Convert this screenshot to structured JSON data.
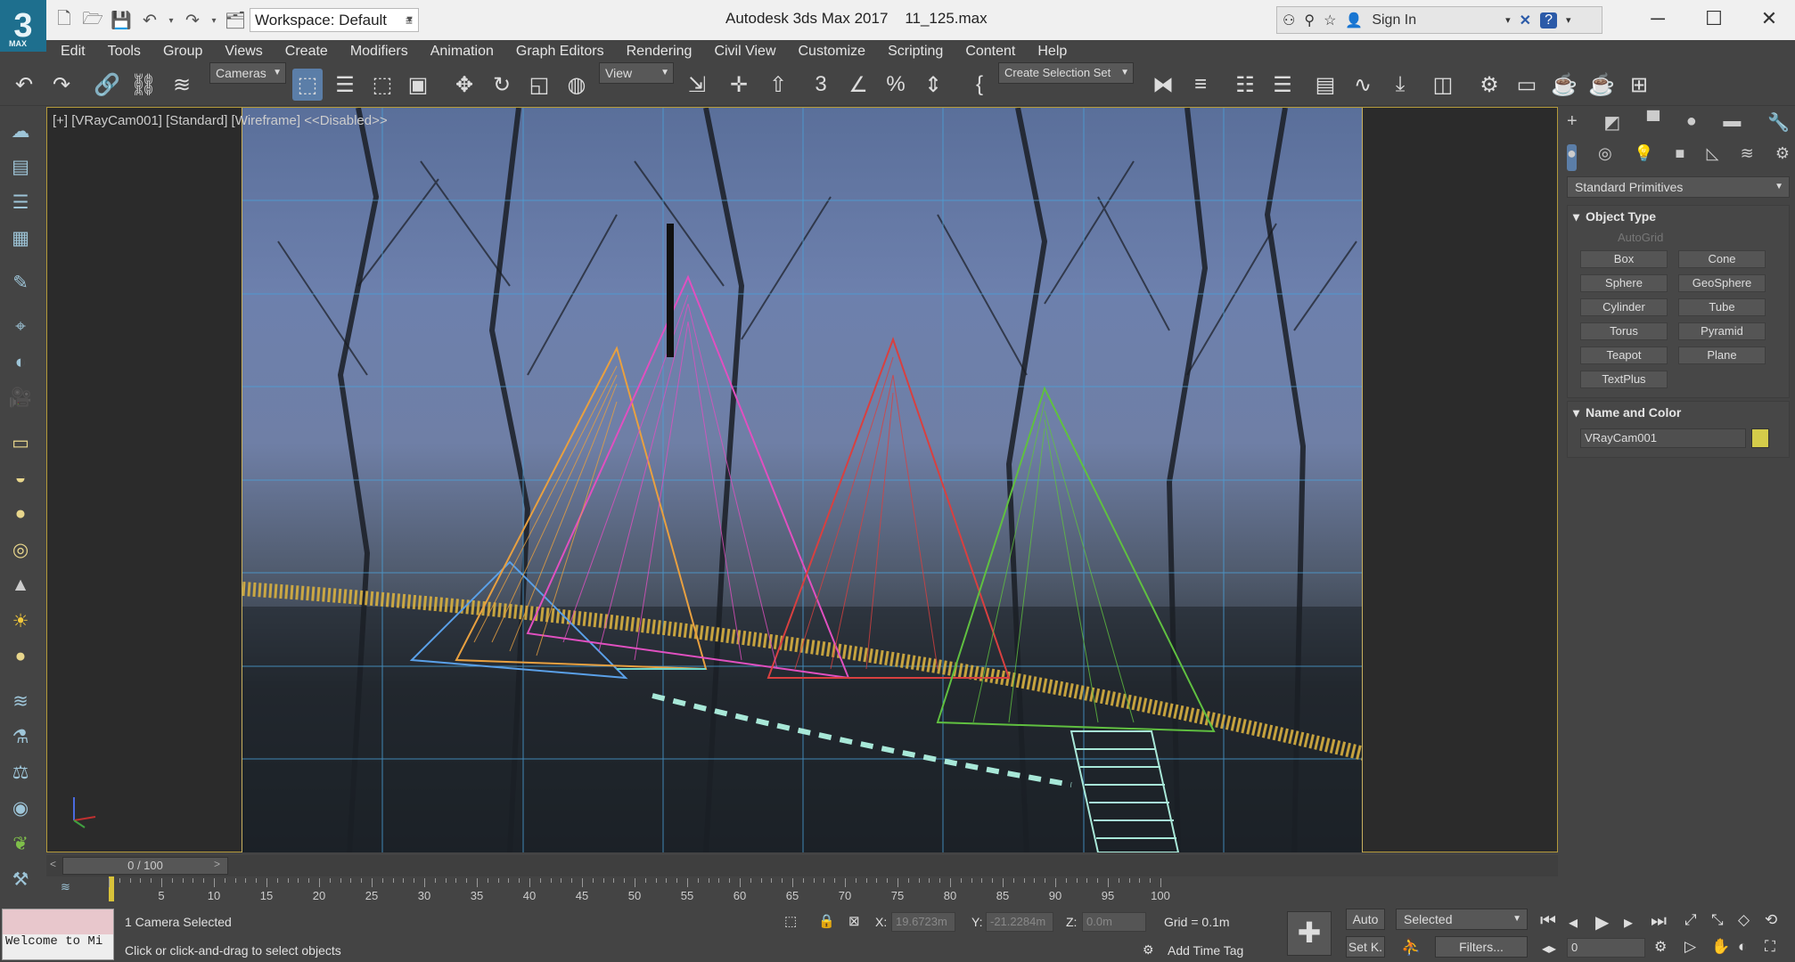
{
  "app": {
    "logo": "3",
    "logo_sub": "MAX",
    "title": "Autodesk 3ds Max 2017",
    "filename": "11_125.max",
    "workspace": "Workspace: Default",
    "sign_in": "Sign In"
  },
  "menu": [
    "Edit",
    "Tools",
    "Group",
    "Views",
    "Create",
    "Modifiers",
    "Animation",
    "Graph Editors",
    "Rendering",
    "Civil View",
    "Customize",
    "Scripting",
    "Content",
    "Help"
  ],
  "toolbar": {
    "filter": "Cameras",
    "ref_coord": "View",
    "selection_set": "Create Selection Set"
  },
  "viewport": {
    "label": "[+] [VRayCam001] [Standard] [Wireframe] <<Disabled>>"
  },
  "command_panel": {
    "dropdown": "Standard Primitives",
    "object_type": {
      "title": "Object Type",
      "autogrid": "AutoGrid",
      "buttons": [
        "Box",
        "Cone",
        "Sphere",
        "GeoSphere",
        "Cylinder",
        "Tube",
        "Torus",
        "Pyramid",
        "Teapot",
        "Plane",
        "TextPlus"
      ]
    },
    "name_color": {
      "title": "Name and Color",
      "name": "VRayCam001",
      "color": "#d4cc4a"
    }
  },
  "timeline": {
    "slider": "0 / 100",
    "ticks": [
      "5",
      "10",
      "15",
      "20",
      "25",
      "30",
      "35",
      "40",
      "45",
      "50",
      "55",
      "60",
      "65",
      "70",
      "75",
      "80",
      "85",
      "90",
      "95",
      "100"
    ]
  },
  "status": {
    "maxscript": "Welcome to Mi",
    "selected": "1 Camera Selected",
    "prompt": "Click or click-and-drag to select objects",
    "x_label": "X:",
    "x_val": "19.6723m",
    "y_label": "Y:",
    "y_val": "-21.2284m",
    "z_label": "Z:",
    "z_val": "0.0m",
    "grid": "Grid = 0.1m",
    "add_time_tag": "Add Time Tag",
    "auto": "Auto",
    "setk": "Set K.",
    "key_mode": "Selected",
    "filters": "Filters...",
    "frame": "0"
  }
}
